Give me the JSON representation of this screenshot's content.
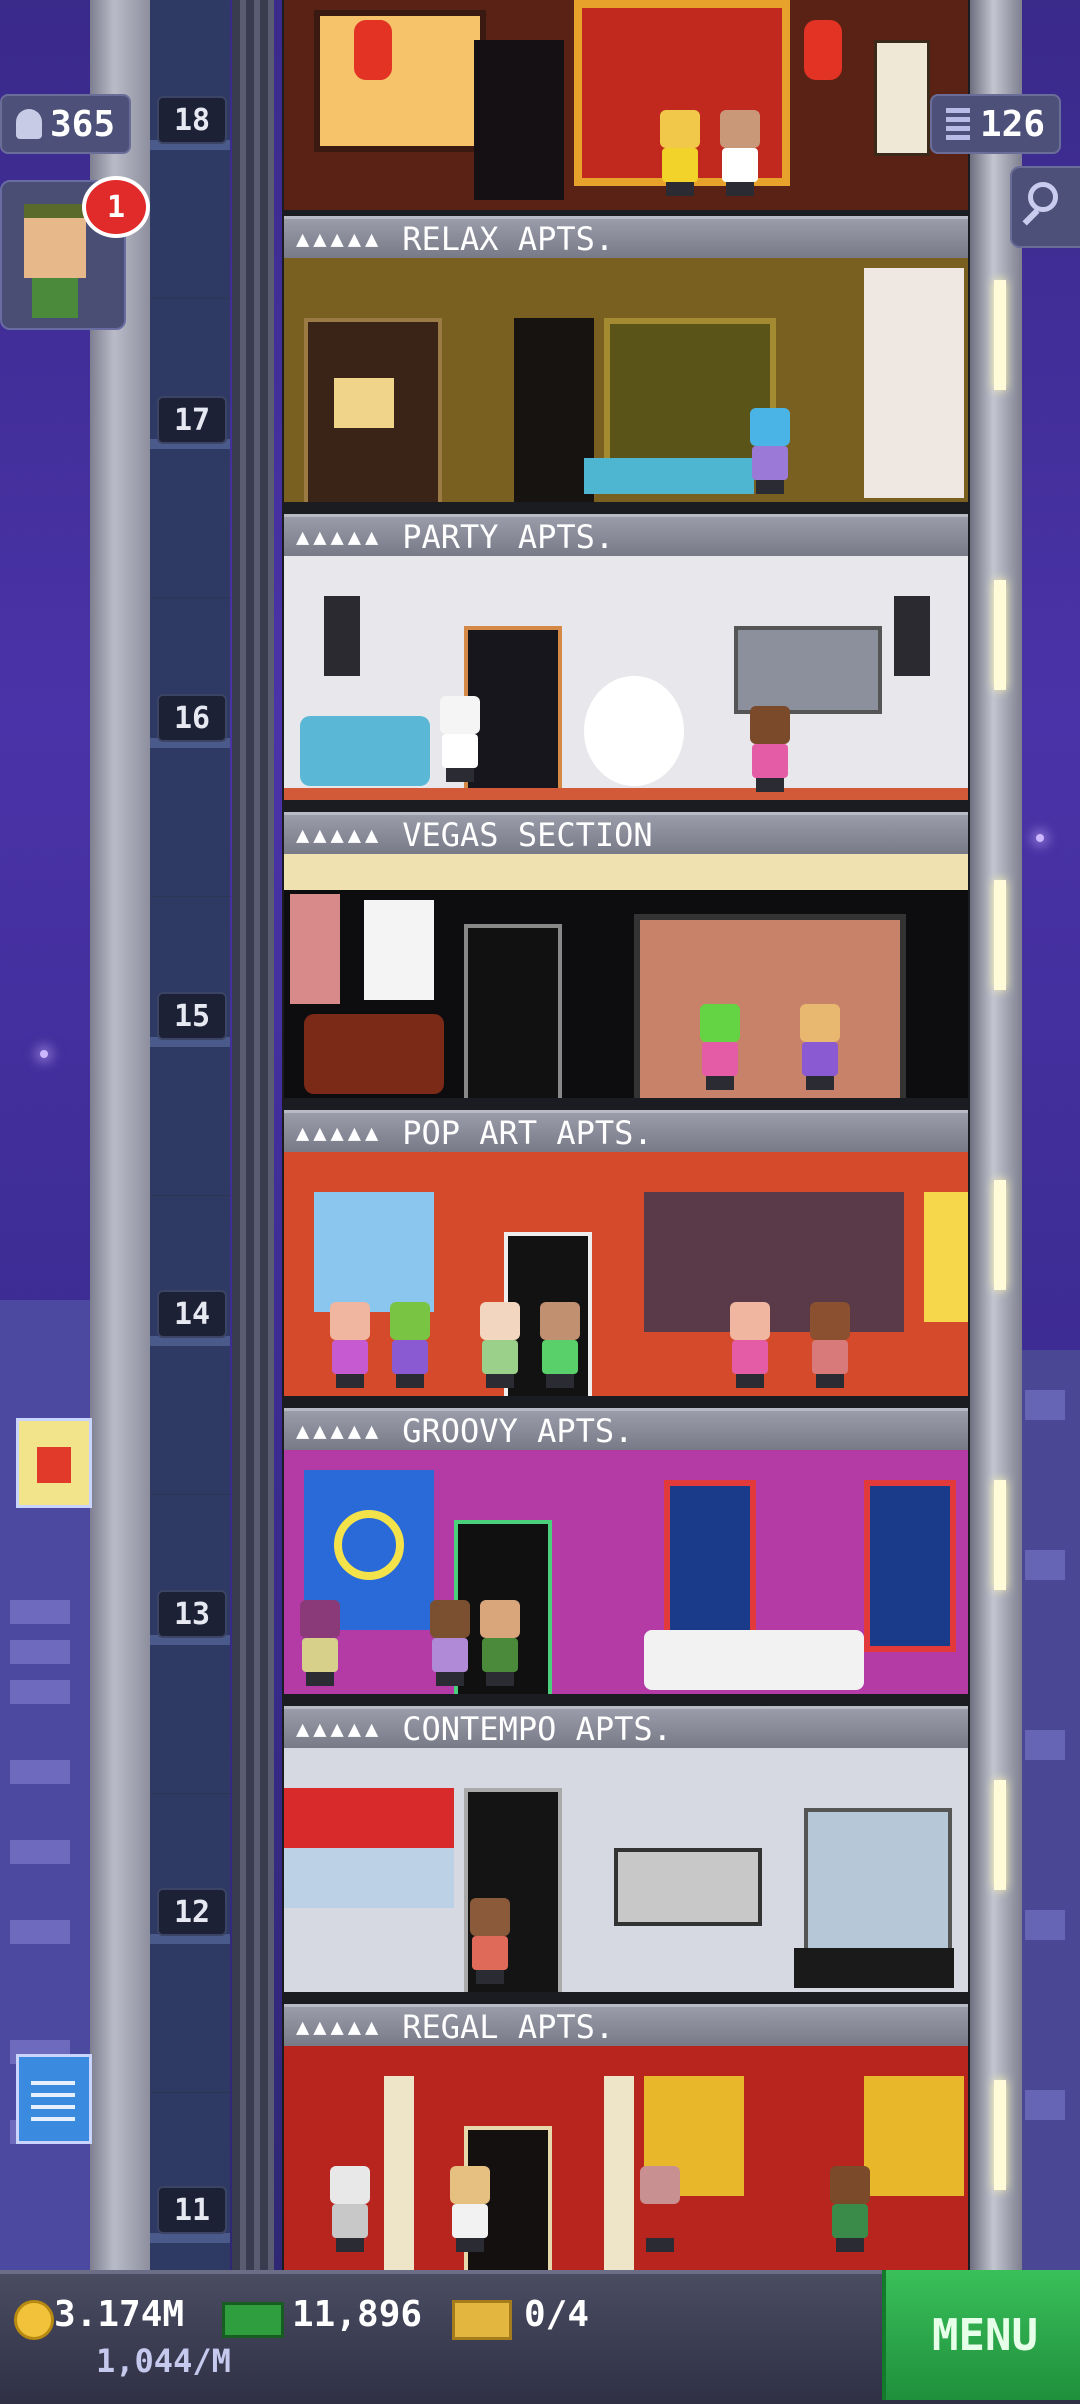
{
  "status": {
    "population": "365",
    "floors": "126",
    "notification_count": "1"
  },
  "floors": [
    {
      "number": "18",
      "sign": null,
      "theme": "chinese"
    },
    {
      "number": "17",
      "sign": "RELAX APTS.",
      "theme": "relax"
    },
    {
      "number": "16",
      "sign": "PARTY APTS.",
      "theme": "party"
    },
    {
      "number": "15",
      "sign": "VEGAS SECTION",
      "theme": "vegas"
    },
    {
      "number": "14",
      "sign": "POP ART APTS.",
      "theme": "popart"
    },
    {
      "number": "13",
      "sign": "GROOVY APTS.",
      "theme": "groovy"
    },
    {
      "number": "12",
      "sign": "CONTEMPO APTS.",
      "theme": "contempo"
    },
    {
      "number": "11",
      "sign": "REGAL APTS.",
      "theme": "regal"
    }
  ],
  "sign_stars": "▲▲▲▲▲",
  "hud": {
    "coins": "3.174M",
    "coins_rate": "1,044/M",
    "bux": "11,896",
    "tickets": "0/4",
    "menu_label": "MENU"
  },
  "icons": {
    "population": "person-icon",
    "floors": "building-icon",
    "search": "magnifier-icon",
    "coin": "coin-icon",
    "bux": "cash-icon",
    "ticket": "ticket-icon"
  },
  "colors": {
    "menu": "#2aa84a",
    "badge": "#e12a2a",
    "coin": "#f2c23a"
  }
}
